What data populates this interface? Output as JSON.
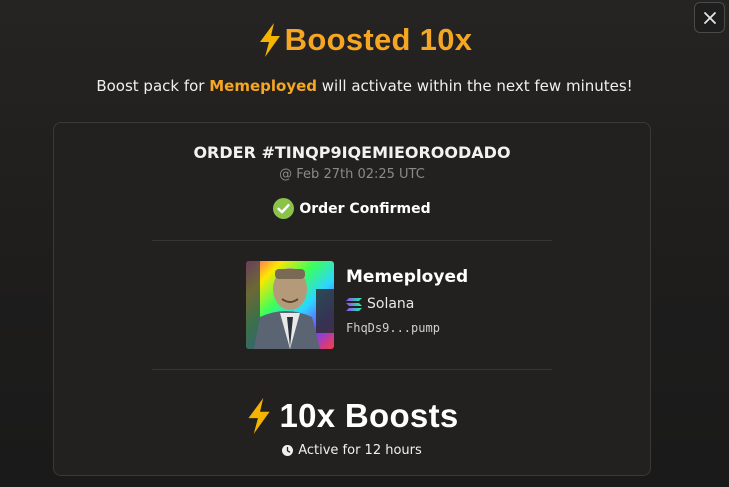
{
  "modal": {
    "title": "Boosted 10x",
    "subtitle_prefix": "Boost pack for ",
    "subtitle_token": "Memeployed",
    "subtitle_suffix": " will activate within the next few minutes!"
  },
  "order": {
    "id": "ORDER #TINQP9IQEMIEOROODADO",
    "timestamp": "@ Feb 27th 02:25 UTC",
    "status": "Order Confirmed"
  },
  "token": {
    "name": "Memeployed",
    "chain": "Solana",
    "address": "FhqDs9...pump"
  },
  "boost": {
    "label": "10x Boosts",
    "duration": "Active for 12 hours"
  },
  "colors": {
    "accent": "#f5a623",
    "check_green": "#8bc34a",
    "lightning": "#f5b400"
  },
  "icons": [
    "lightning-icon",
    "close-icon",
    "check-circle-icon",
    "solana-icon",
    "clock-icon"
  ]
}
